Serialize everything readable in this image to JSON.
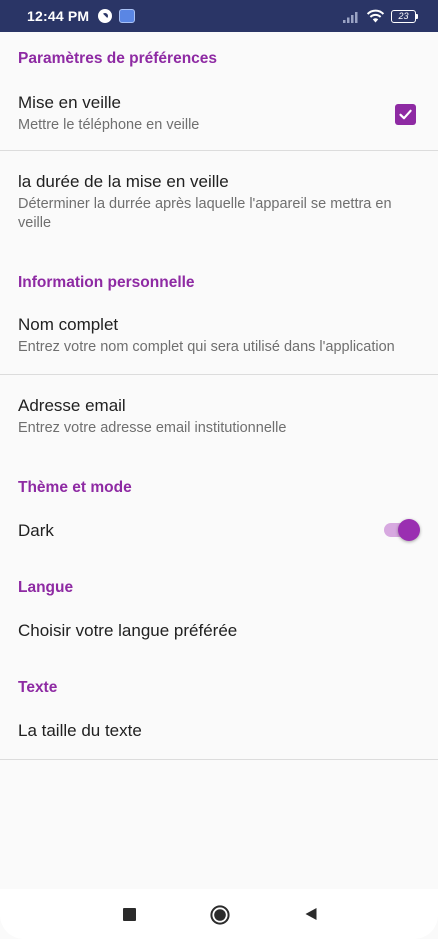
{
  "status_bar": {
    "time": "12:44 PM",
    "battery": "23",
    "icons": [
      "app-notification-icon",
      "gallery-icon",
      "signal-icon",
      "wifi-icon",
      "battery-icon"
    ]
  },
  "sections": {
    "preferences": {
      "title": "Paramètres de préférences",
      "sleep": {
        "title": "Mise en veille",
        "summary": "Mettre le téléphone en veille",
        "checked": true
      },
      "sleep_duration": {
        "title": "la durée de la mise en veille",
        "summary": "Déterminer la durrée après laquelle l'appareil se mettra en veille"
      }
    },
    "personal": {
      "title": "Information personnelle",
      "full_name": {
        "title": "Nom complet",
        "summary": "Entrez votre nom complet qui sera utilisé dans l'application"
      },
      "email": {
        "title": "Adresse email",
        "summary": "Entrez votre adresse email institutionnelle"
      }
    },
    "theme": {
      "title": "Thème et mode",
      "dark": {
        "title": "Dark",
        "enabled": true
      }
    },
    "language": {
      "title": "Langue",
      "choose": {
        "title": "Choisir votre langue préférée"
      }
    },
    "text": {
      "title": "Texte",
      "size": {
        "title": "La taille du texte"
      }
    }
  },
  "nav_bar": {
    "buttons": [
      "recents-icon",
      "home-icon",
      "back-icon"
    ]
  },
  "colors": {
    "accent": "#8e2aa3",
    "status_bar": "#2a3566",
    "background": "#fafafa"
  }
}
